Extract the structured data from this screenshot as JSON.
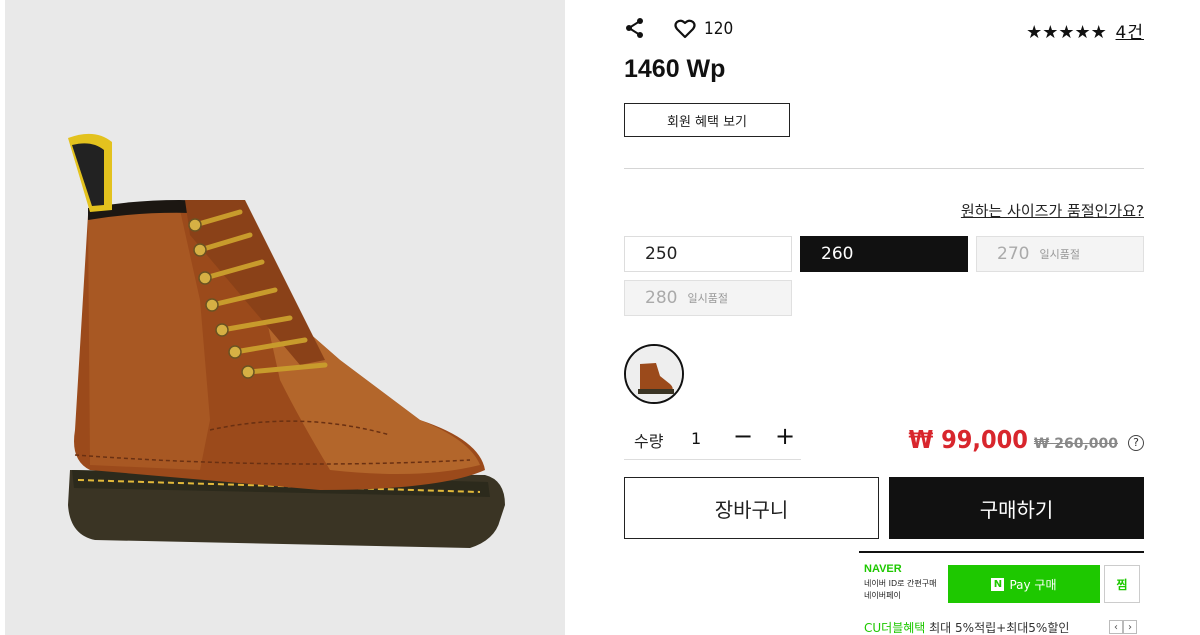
{
  "header": {
    "like_count": "120",
    "stars": "★★★★★",
    "review_count": "4건"
  },
  "product": {
    "title": "1460 Wp",
    "benefit_button": "회원 혜택 보기",
    "soldout_link": "원하는 사이즈가 품절인가요?"
  },
  "sizes": [
    {
      "label": "250",
      "state": "available",
      "note": ""
    },
    {
      "label": "260",
      "state": "selected",
      "note": ""
    },
    {
      "label": "270",
      "state": "soldout",
      "note": "일시품절"
    },
    {
      "label": "280",
      "state": "soldout",
      "note": "일시품절"
    }
  ],
  "quantity": {
    "label": "수량",
    "value": "1",
    "minus": "−",
    "plus": "+"
  },
  "price": {
    "sale": "₩ 99,000",
    "original": "₩ 260,000",
    "help": "?"
  },
  "actions": {
    "cart": "장바구니",
    "buy": "구매하기"
  },
  "naverpay": {
    "logo": "NAVER",
    "desc_line1": "네이버 ID로 간편구매",
    "desc_line2": "네이버페이",
    "n_mark": "N",
    "button": "Pay 구매",
    "wish": "찜",
    "cu_brand": "CU더블혜택",
    "cu_text": " 최대 5%적립+최대5%할인",
    "prev": "‹",
    "next": "›"
  },
  "colors": {
    "sale_red": "#d8262d",
    "naver_green": "#1ec800",
    "selected_black": "#111111"
  }
}
